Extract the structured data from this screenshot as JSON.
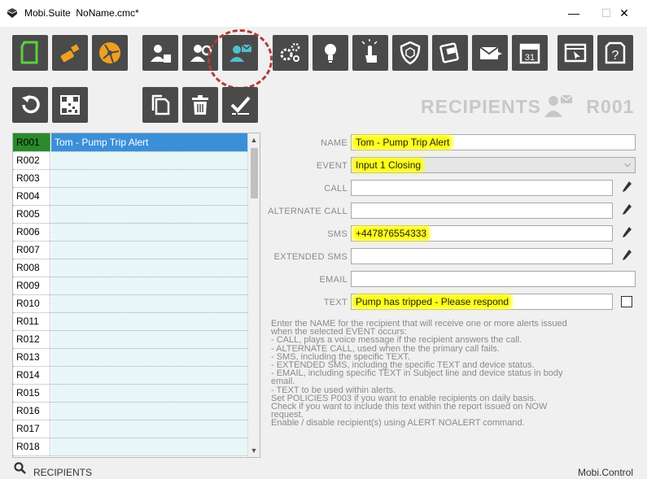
{
  "window": {
    "app_name": "Mobi.Suite",
    "file_name": "NoName.cmc*",
    "minimize": "—",
    "maximize": "☐",
    "close": "✕"
  },
  "toolbar": {
    "main_buttons": [
      "new-file-icon",
      "usb-icon",
      "network-icon",
      "user-card-icon",
      "user-settings-icon",
      "recipient-mail-icon",
      "gears-icon",
      "lightbulb-icon",
      "touch-icon",
      "shield-icon",
      "mobile-device-icon",
      "send-mail-icon",
      "calendar-icon",
      "window-cursor-icon",
      "help-document-icon"
    ],
    "calendar_day": "31",
    "secondary_buttons": [
      "undo-icon",
      "qr-code-icon",
      "copy-icon",
      "delete-icon",
      "check-list-icon"
    ]
  },
  "page": {
    "heading": "RECIPIENTS",
    "code": "R001"
  },
  "list": {
    "rows": [
      {
        "code": "R001",
        "name": "Tom - Pump Trip Alert"
      },
      {
        "code": "R002",
        "name": ""
      },
      {
        "code": "R003",
        "name": ""
      },
      {
        "code": "R004",
        "name": ""
      },
      {
        "code": "R005",
        "name": ""
      },
      {
        "code": "R006",
        "name": ""
      },
      {
        "code": "R007",
        "name": ""
      },
      {
        "code": "R008",
        "name": ""
      },
      {
        "code": "R009",
        "name": ""
      },
      {
        "code": "R010",
        "name": ""
      },
      {
        "code": "R011",
        "name": ""
      },
      {
        "code": "R012",
        "name": ""
      },
      {
        "code": "R013",
        "name": ""
      },
      {
        "code": "R014",
        "name": ""
      },
      {
        "code": "R015",
        "name": ""
      },
      {
        "code": "R016",
        "name": ""
      },
      {
        "code": "R017",
        "name": ""
      },
      {
        "code": "R018",
        "name": ""
      }
    ],
    "scroll_up": "▲",
    "scroll_down": "▼"
  },
  "form": {
    "name_label": "NAME",
    "name_value": "Tom - Pump Trip Alert",
    "event_label": "EVENT",
    "event_value": "Input 1 Closing",
    "call_label": "CALL",
    "call_value": "",
    "alt_call_label": "ALTERNATE CALL",
    "alt_call_value": "",
    "sms_label": "SMS",
    "sms_value": "+447876554333",
    "ext_sms_label": "EXTENDED SMS",
    "ext_sms_value": "",
    "email_label": "EMAIL",
    "email_value": "",
    "text_label": "TEXT",
    "text_value": "Pump has tripped - Please respond"
  },
  "help_lines": [
    "Enter the NAME for the recipient that will receive one or more alerts issued",
    "when the selected EVENT occurs:",
    "- CALL, plays a voice message if the recipient answers the call.",
    "- ALTERNATE CALL, used when the the primary call fails.",
    "- SMS, including the specific TEXT.",
    "- EXTENDED SMS, including the specific TEXT and device status.",
    "- EMAIL, including specific TEXT in Subject line and device status in body",
    "email.",
    "- TEXT to be used within alerts.",
    "Set POLICIES P003 if you want to enable recipients on daily basis.",
    "Check if you want to include this text within the report issued on NOW",
    "request.",
    "Enable / disable recipient(s) using ALERT NOALERT command."
  ],
  "status": {
    "left": "RECIPIENTS",
    "right": "Mobi.Control"
  },
  "colors": {
    "toolbar_bg": "#4a4a4a",
    "accent_green": "#5bd13b",
    "accent_orange": "#f0a020",
    "icon_teal": "#4fbfcf",
    "highlight": "#ffff1a",
    "selected_row": "#3b8fd9",
    "circle": "#b53a3a"
  }
}
